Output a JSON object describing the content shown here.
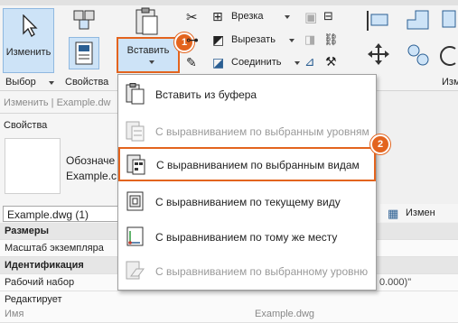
{
  "ribbon": {
    "modify_label": "Изменить",
    "select_label": "Выбор",
    "properties_label": "Свойства",
    "paste_label": "Вставить",
    "cut_label": "Вырезать",
    "join_label": "Соединить",
    "notch_label": "Врезка",
    "right_partial_label": "Изм",
    "badge_1": "1",
    "badge_2": "2"
  },
  "panel": {
    "breadcrumb": "Изменить | Example.dw",
    "header": "Свойства",
    "type_name_line1": "Обозначе",
    "type_name_line2": "Example.c",
    "selector_value": "Example.dwg (1)",
    "edit_type_button": "Измен",
    "rows": [
      {
        "label": "Размеры",
        "group": true
      },
      {
        "label": "Масштаб экземпляра",
        "group": false
      },
      {
        "label": "Идентификация",
        "group": true
      },
      {
        "label": "Рабочий набор",
        "group": false,
        "value": "0.000)\""
      },
      {
        "label": "Редактирует",
        "group": false
      },
      {
        "label": "Имя",
        "group": false,
        "value": "Example.dwg"
      }
    ]
  },
  "paste_menu": {
    "items": [
      {
        "label": "Вставить из буфера",
        "enabled": true
      },
      {
        "label": "С выравниванием по выбранным уровням",
        "enabled": false
      },
      {
        "label": "С выравниванием по выбранным видам",
        "enabled": true,
        "highlighted": true
      },
      {
        "label": "С выравниванием по текущему виду",
        "enabled": true
      },
      {
        "label": "С выравниванием по тому же месту",
        "enabled": true
      },
      {
        "label": "С выравниванием по выбранному уровню",
        "enabled": false
      }
    ]
  },
  "colors": {
    "accent": "#e3641e",
    "selected_bg": "#cde3f7"
  }
}
